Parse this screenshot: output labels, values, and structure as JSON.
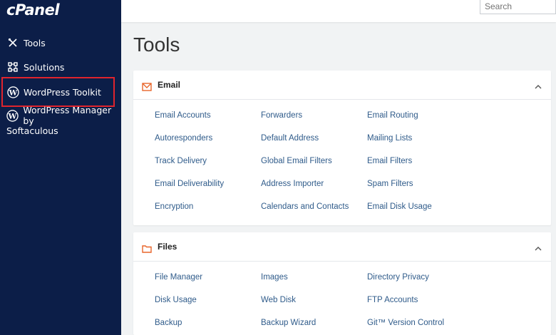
{
  "brand": {
    "logo_text": "cPanel"
  },
  "sidebar": {
    "items": [
      {
        "label": "Tools"
      },
      {
        "label": "Solutions"
      },
      {
        "label": "WordPress Toolkit"
      },
      {
        "label_line1": "WordPress Manager by",
        "label_line2": "Softaculous"
      }
    ]
  },
  "topbar": {
    "search_placeholder": "Search"
  },
  "page": {
    "title": "Tools"
  },
  "panels": [
    {
      "title": "Email",
      "icon": "envelope-icon",
      "columns": [
        [
          "Email Accounts",
          "Autoresponders",
          "Track Delivery",
          "Email Deliverability",
          "Encryption"
        ],
        [
          "Forwarders",
          "Default Address",
          "Global Email Filters",
          "Address Importer",
          "Calendars and Contacts"
        ],
        [
          "Email Routing",
          "Mailing Lists",
          "Email Filters",
          "Spam Filters",
          "Email Disk Usage"
        ]
      ]
    },
    {
      "title": "Files",
      "icon": "folder-icon",
      "columns": [
        [
          "File Manager",
          "Disk Usage",
          "Backup"
        ],
        [
          "Images",
          "Web Disk",
          "Backup Wizard"
        ],
        [
          "Directory Privacy",
          "FTP Accounts",
          "Git™ Version Control"
        ]
      ]
    }
  ],
  "colors": {
    "sidebar_bg": "#0c1e48",
    "link": "#2f5b8a",
    "accent_orange": "#e8652a",
    "highlight_red": "#e0242d"
  }
}
